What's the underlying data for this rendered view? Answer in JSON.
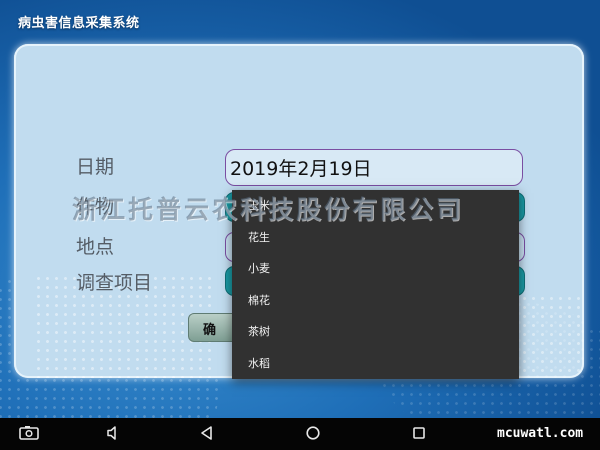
{
  "app": {
    "title": "病虫害信息采集系统"
  },
  "form": {
    "date_label": "日期",
    "date_value": "2019年2月19日",
    "crop_label": "作物",
    "location_label": "地点",
    "survey_label": "调查项目",
    "confirm_label": "确 定"
  },
  "crop_dropdown": {
    "options": [
      "玉米",
      "花生",
      "小麦",
      "棉花",
      "茶树",
      "水稻"
    ]
  },
  "overlay": {
    "company_watermark": "浙江托普云农科技股份有限公司",
    "site_watermark": "mcuwatl.com"
  },
  "colors": {
    "panel": "#c1dcef",
    "field_teal": "#1a9aa4",
    "dropdown": "#313131",
    "field_border": "#7a4ea2"
  },
  "icons": {
    "screenshot": "screenshot-icon",
    "volume": "volume-icon",
    "back": "back-icon",
    "home": "home-icon",
    "recents": "recents-icon"
  }
}
